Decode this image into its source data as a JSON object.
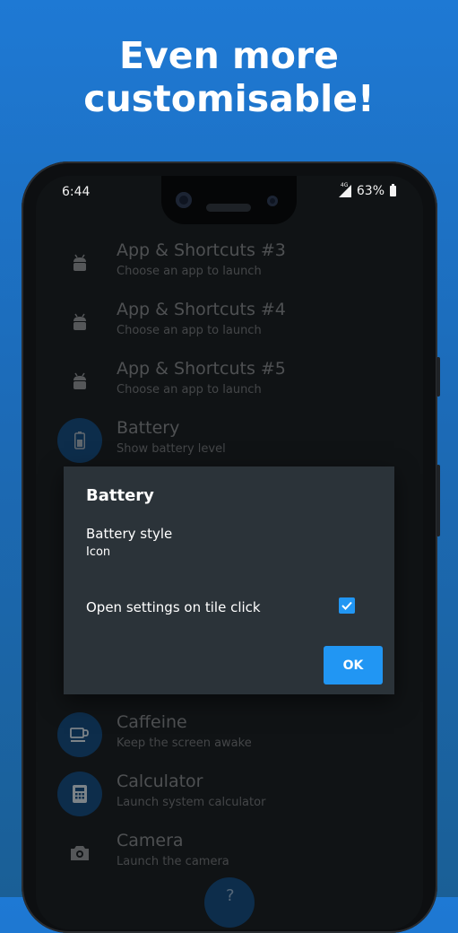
{
  "headline": {
    "line1": "Even more",
    "line2": "customisable!"
  },
  "status_bar": {
    "time": "6:44",
    "network": "4G",
    "battery": "63%"
  },
  "list_items": [
    {
      "title": "App & Shortcuts #3",
      "subtitle": "Choose an app to launch",
      "icon": "android-icon",
      "circled": false
    },
    {
      "title": "App & Shortcuts #4",
      "subtitle": "Choose an app to launch",
      "icon": "android-icon",
      "circled": false
    },
    {
      "title": "App & Shortcuts #5",
      "subtitle": "Choose an app to launch",
      "icon": "android-icon",
      "circled": false
    },
    {
      "title": "Battery",
      "subtitle": "Show battery level",
      "icon": "battery-icon",
      "circled": true
    },
    {
      "title": "Caffeine",
      "subtitle": "Keep the screen awake",
      "icon": "coffee-cup-icon",
      "circled": true
    },
    {
      "title": "Calculator",
      "subtitle": "Launch system calculator",
      "icon": "calculator-icon",
      "circled": true
    },
    {
      "title": "Camera",
      "subtitle": "Launch the camera",
      "icon": "camera-icon",
      "circled": false
    }
  ],
  "dialog": {
    "title": "Battery",
    "pref_title": "Battery style",
    "pref_value": "Icon",
    "switch_label": "Open settings on tile click",
    "checked": true,
    "ok_label": "OK"
  },
  "colors": {
    "accent": "#2196f3",
    "background_top": "#1e79d4",
    "dialog_bg": "#2b3339",
    "icon_circle": "#15497a"
  }
}
